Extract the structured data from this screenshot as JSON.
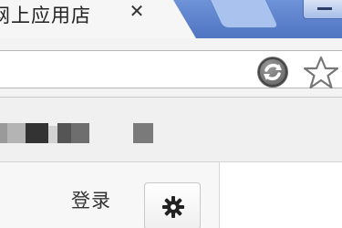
{
  "tab": {
    "title": "网上应用店",
    "close_label": "✕"
  },
  "toolbar": {
    "sync_icon": "sync-icon",
    "bookmark_icon": "star-icon"
  },
  "content": {
    "login_label": "登录",
    "settings_icon": "gear-icon"
  },
  "colors": {
    "tabstrip": "#5a7fc9",
    "toolbar": "#f3f3f3",
    "content": "#f7f7f7"
  }
}
